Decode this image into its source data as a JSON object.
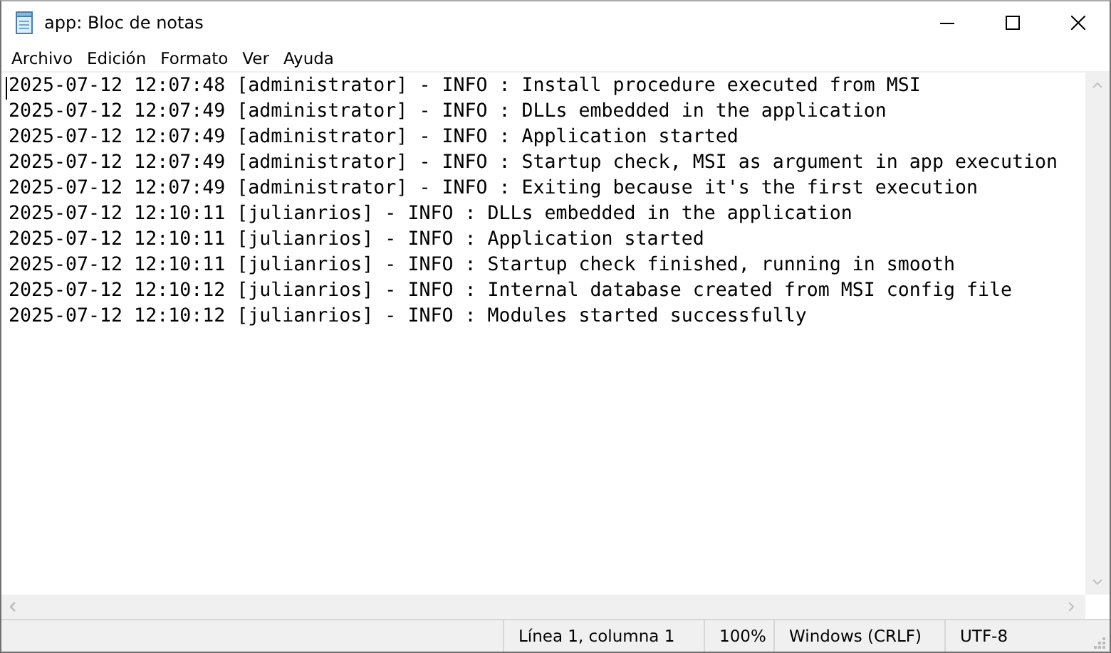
{
  "window": {
    "title": "app: Bloc de notas"
  },
  "menu": [
    "Archivo",
    "Edición",
    "Formato",
    "Ver",
    "Ayuda"
  ],
  "lines": [
    "2025-07-12 12:07:48 [administrator] - INFO : Install procedure executed from MSI",
    "2025-07-12 12:07:49 [administrator] - INFO : DLLs embedded in the application",
    "2025-07-12 12:07:49 [administrator] - INFO : Application started",
    "2025-07-12 12:07:49 [administrator] - INFO : Startup check, MSI as argument in app execution",
    "2025-07-12 12:07:49 [administrator] - INFO : Exiting because it's the first execution",
    "2025-07-12 12:10:11 [julianrios] - INFO : DLLs embedded in the application",
    "2025-07-12 12:10:11 [julianrios] - INFO : Application started",
    "2025-07-12 12:10:11 [julianrios] - INFO : Startup check finished, running in smooth",
    "2025-07-12 12:10:12 [julianrios] - INFO : Internal database created from MSI config file",
    "2025-07-12 12:10:12 [julianrios] - INFO : Modules started successfully"
  ],
  "status_bar": [
    "Línea 1, columna 1",
    "100%",
    "Windows (CRLF)",
    "UTF-8"
  ]
}
